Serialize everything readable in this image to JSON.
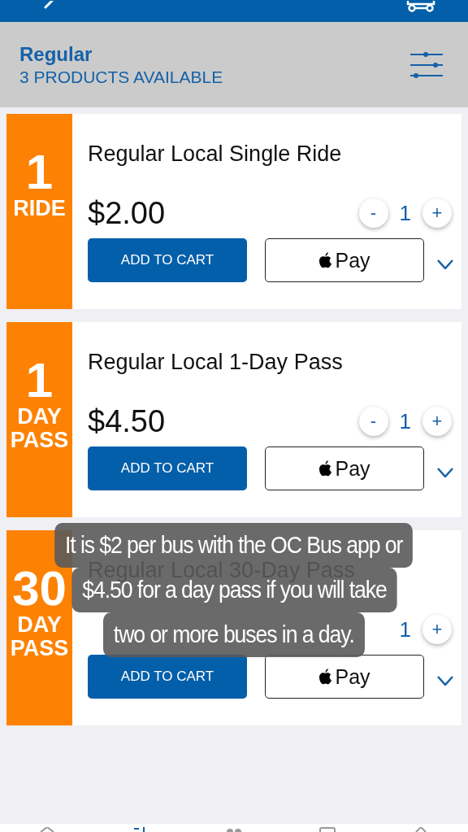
{
  "category": {
    "title": "Regular",
    "subtitle": "3 PRODUCTS AVAILABLE"
  },
  "products": [
    {
      "badge_number": "1",
      "badge_unit": "RIDE",
      "name": "Regular Local Single Ride",
      "price": "$2.00",
      "minus": "-",
      "quantity": "1",
      "plus": "+",
      "add_label": "ADD TO CART",
      "pay_label": "Pay"
    },
    {
      "badge_number": "1",
      "badge_unit": "DAY PASS",
      "name": "Regular Local 1-Day Pass",
      "price": "$4.50",
      "minus": "-",
      "quantity": "1",
      "plus": "+",
      "add_label": "ADD TO CART",
      "pay_label": "Pay"
    },
    {
      "badge_number": "30",
      "badge_unit": "DAY PASS",
      "name": "Regular Local 30-Day Pass",
      "quantity": "1",
      "plus": "+",
      "add_label": "ADD TO CART",
      "pay_label": "Pay"
    }
  ],
  "caption": {
    "lines": [
      "It is $2 per bus with the OC Bus app or",
      "$4.50 for a day pass if you will take",
      "two or more buses in a day."
    ]
  }
}
